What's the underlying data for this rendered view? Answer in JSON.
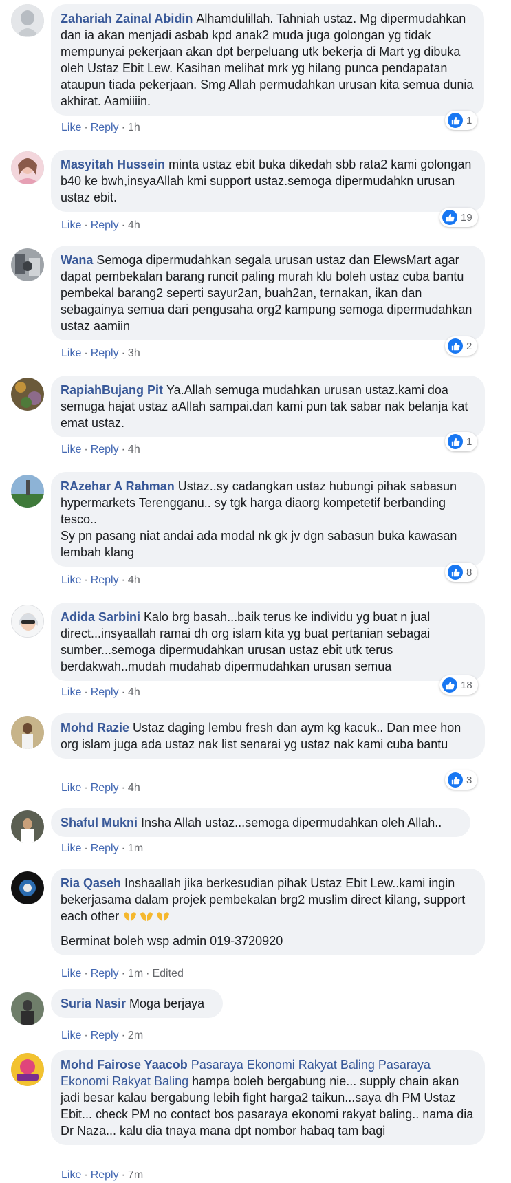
{
  "actions": {
    "like": "Like",
    "reply": "Reply",
    "edited": "Edited"
  },
  "comments": [
    {
      "name": "Zahariah Zainal Abidin",
      "text": "Alhamdulillah. Tahniah ustaz. Mg dipermudahkan dan ia akan menjadi asbab kpd anak2 muda juga golongan yg tidak mempunyai pekerjaan akan dpt berpeluang utk bekerja di Mart yg dibuka oleh Ustaz Ebit Lew. Kasihan melihat mrk yg hilang punca pendapatan ataupun tiada pekerjaan. Smg Allah permudahkan urusan kita semua dunia akhirat. Aamiiiin.",
      "time": "1h",
      "likes": "1"
    },
    {
      "name": "Masyitah Hussein",
      "text": "minta ustaz ebit buka dikedah sbb rata2 kami golongan b40 ke bwh,insyaAllah kmi support ustaz.semoga dipermudahkn urusan ustaz ebit.",
      "time": "4h",
      "likes": "19"
    },
    {
      "name": "Wana",
      "text": "Semoga dipermudahkan segala urusan ustaz dan ElewsMart agar dapat pembekalan barang runcit paling murah klu boleh ustaz cuba bantu pembekal barang2 seperti sayur2an, buah2an, ternakan, ikan dan sebagainya semua dari pengusaha org2 kampung semoga dipermudahkan ustaz aamiin",
      "time": "3h",
      "likes": "2"
    },
    {
      "name": "RapiahBujang Pit",
      "text": "Ya.Allah semuga mudahkan urusan ustaz.kami doa semuga hajat ustaz aAllah sampai.dan kami pun tak sabar nak belanja kat emat ustaz.",
      "time": "4h",
      "likes": "1"
    },
    {
      "name": "RAzehar A Rahman",
      "text": "Ustaz..sy cadangkan ustaz hubungi pihak sabasun hypermarkets Terengganu.. sy tgk harga diaorg kompetetif berbanding tesco..",
      "text2": "Sy pn pasang niat andai ada modal nk gk jv dgn sabasun buka kawasan lembah klang",
      "time": "4h",
      "likes": "8"
    },
    {
      "name": "Adida Sarbini",
      "text": "Kalo brg basah...baik terus ke individu yg buat n jual direct...insyaallah ramai dh org islam kita yg buat pertanian sebagai sumber...semoga dipermudahkan urusan ustaz ebit utk terus berdakwah..mudah mudahab dipermudahkan urusan semua",
      "time": "4h",
      "likes": "18"
    },
    {
      "name": "Mohd Razie",
      "text": "Ustaz daging lembu fresh dan aym kg kacuk.. Dan mee hon org islam juga ada ustaz nak list senarai yg ustaz nak kami cuba bantu",
      "time": "4h",
      "likes": "3"
    },
    {
      "name": "Shaful Mukni",
      "text": "Insha Allah ustaz...semoga dipermudahkan oleh Allah..",
      "time": "1m"
    },
    {
      "name": "Ria Qaseh",
      "text": "Inshaallah jika berkesudian pihak Ustaz Ebit Lew..kami ingin bekerjasama dalam projek pembekalan brg2 muslim direct kilang, support each other",
      "text2": "Berminat boleh wsp admin 019-3720920",
      "time": "1m",
      "edited": true
    },
    {
      "name": "Suria Nasir",
      "text": "Moga berjaya",
      "time": "2m"
    },
    {
      "name": "Mohd Fairose Yaacob",
      "mention": "Pasaraya Ekonomi Rakyat Baling Pasaraya Ekonomi Rakyat Baling",
      "text": "hampa boleh bergabung nie... supply chain akan jadi besar kalau bergabung lebih fight harga2 taikun...saya dh PM Ustaz Ebit... check PM no contact bos pasaraya ekonomi rakyat baling.. nama dia Dr Naza... kalu dia tnaya mana dpt nombor habaq tam bagi",
      "time": "7m"
    }
  ]
}
